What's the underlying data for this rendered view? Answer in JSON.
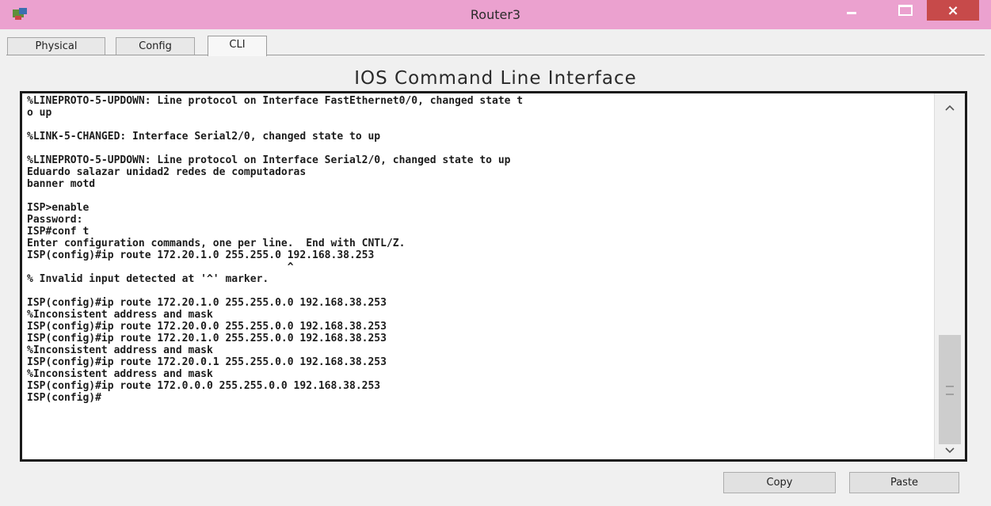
{
  "window": {
    "title": "Router3",
    "close_glyph": "×",
    "icons": [
      "router-app-icon",
      "minimize-icon",
      "maximize-icon",
      "close-icon"
    ]
  },
  "tabs": [
    {
      "label": "Physical",
      "active": false
    },
    {
      "label": "Config",
      "active": false
    },
    {
      "label": "CLI",
      "active": true
    }
  ],
  "main": {
    "heading": "IOS Command Line Interface",
    "terminal_lines": [
      "%LINEPROTO-5-UPDOWN: Line protocol on Interface FastEthernet0/0, changed state t",
      "o up",
      "",
      "%LINK-5-CHANGED: Interface Serial2/0, changed state to up",
      "",
      "%LINEPROTO-5-UPDOWN: Line protocol on Interface Serial2/0, changed state to up",
      "Eduardo salazar unidad2 redes de computadoras",
      "banner motd",
      "",
      "ISP>enable",
      "Password:",
      "ISP#conf t",
      "Enter configuration commands, one per line.  End with CNTL/Z.",
      "ISP(config)#ip route 172.20.1.0 255.255.0 192.168.38.253",
      "                                          ^",
      "% Invalid input detected at '^' marker.",
      "",
      "ISP(config)#ip route 172.20.1.0 255.255.0.0 192.168.38.253",
      "%Inconsistent address and mask",
      "ISP(config)#ip route 172.20.0.0 255.255.0.0 192.168.38.253",
      "ISP(config)#ip route 172.20.1.0 255.255.0.0 192.168.38.253",
      "%Inconsistent address and mask",
      "ISP(config)#ip route 172.20.0.1 255.255.0.0 192.168.38.253",
      "%Inconsistent address and mask",
      "ISP(config)#ip route 172.0.0.0 255.255.0.0 192.168.38.253",
      "ISP(config)#"
    ]
  },
  "buttons": {
    "copy_label": "Copy",
    "paste_label": "Paste"
  },
  "colors": {
    "titlebar": "#eba1cf",
    "close_button": "#c74a4a",
    "terminal_bg": "#ffffff",
    "terminal_text": "#1c1c1c"
  }
}
